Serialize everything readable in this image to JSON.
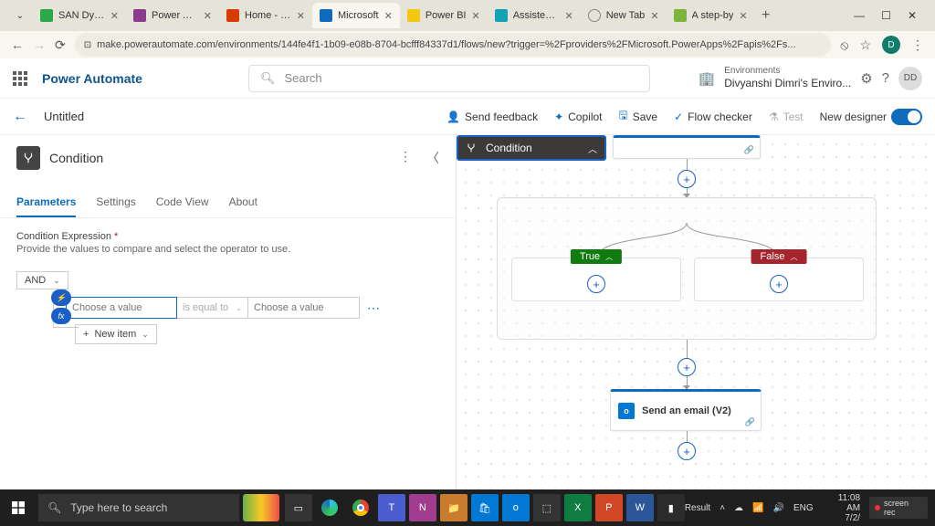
{
  "browser": {
    "tabs": [
      {
        "title": "SAN Dyna",
        "color": "#2aa84a"
      },
      {
        "title": "Power App",
        "color": "#8b3a8d"
      },
      {
        "title": "Home - Po",
        "color": "#d83b01"
      },
      {
        "title": "Microsoft",
        "color": "#0f6cbd",
        "active": true
      },
      {
        "title": "Power BI",
        "color": "#f2c811"
      },
      {
        "title": "Assisted S",
        "color": "#13a3b5"
      },
      {
        "title": "New Tab",
        "color": "#888"
      },
      {
        "title": "A step-by",
        "color": "#7db53c"
      }
    ],
    "url": "make.powerautomate.com/environments/144fe4f1-1b09-e08b-8704-bcfff84337d1/flows/new?trigger=%2Fproviders%2FMicrosoft.PowerApps%2Fapis%2Fs...",
    "avatar": "D"
  },
  "app": {
    "brand": "Power Automate",
    "search_ph": "Search",
    "env_label": "Environments",
    "env_name": "Divyanshi Dimri's Enviro...",
    "initials": "DD"
  },
  "cmd": {
    "title": "Untitled",
    "feedback": "Send feedback",
    "copilot": "Copilot",
    "save": "Save",
    "checker": "Flow checker",
    "test": "Test",
    "newd": "New designer"
  },
  "panel": {
    "title": "Condition",
    "tabs": {
      "parameters": "Parameters",
      "settings": "Settings",
      "code": "Code View",
      "about": "About"
    },
    "expr_label": "Condition Expression",
    "hint": "Provide the values to compare and select the operator to use.",
    "and": "AND",
    "choose": "Choose a value",
    "op": "is equal to",
    "newitem": "New item"
  },
  "canvas": {
    "condition": "Condition",
    "true": "True",
    "false": "False",
    "email": "Send an email (V2)"
  },
  "taskbar": {
    "search": "Type here to search",
    "result": "Result",
    "lang": "ENG",
    "time": "11:08 AM",
    "date": "7/2/",
    "rec": "screen rec"
  }
}
